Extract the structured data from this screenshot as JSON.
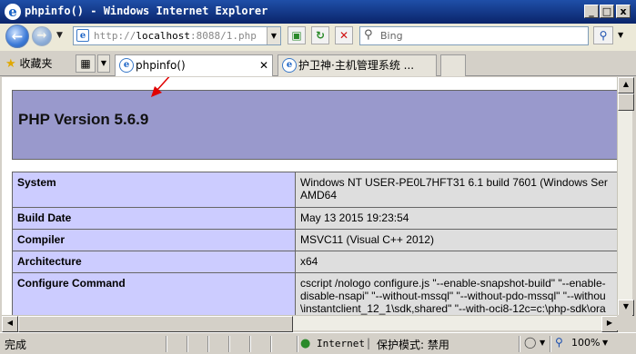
{
  "window": {
    "title": "phpinfo() - Windows Internet Explorer",
    "min_label": "_",
    "max_label": "□",
    "close_label": "x"
  },
  "address": {
    "url_prefix": "http://",
    "url_host": "localhost",
    "url_rest": ":8088/1.php",
    "search_placeholder": "Bing"
  },
  "favorites": {
    "label": "收藏夹"
  },
  "tabs": [
    {
      "label": "phpinfo()",
      "active": true
    },
    {
      "label": "护卫神·主机管理系统 ...",
      "active": false
    }
  ],
  "page": {
    "version_heading": "PHP Version 5.6.9",
    "rows": [
      {
        "key": "System",
        "value": "Windows NT USER-PE0L7HFT31 6.1 build 7601 (Windows Ser",
        "value2": "AMD64"
      },
      {
        "key": "Build Date",
        "value": "May 13 2015 19:23:54"
      },
      {
        "key": "Compiler",
        "value": "MSVC11 (Visual C++ 2012)"
      },
      {
        "key": "Architecture",
        "value": "x64"
      },
      {
        "key": "Configure Command",
        "value": "cscript /nologo configure.js \"--enable-snapshot-build\" \"--enable-",
        "value2": "disable-nsapi\" \"--without-mssql\" \"--without-pdo-mssql\" \"--withou",
        "value3": "\\instantclient_12_1\\sdk,shared\" \"--with-oci8-12c=c:\\php-sdk\\ora"
      }
    ]
  },
  "statusbar": {
    "status_text": "完成",
    "zone": "Internet",
    "protected_mode": "保护模式: 禁用",
    "zoom": "100%"
  },
  "colors": {
    "php_header": "#9999cc",
    "key_cell": "#ccccff",
    "value_cell": "#dedede",
    "annotation_arrow": "#e00000"
  }
}
